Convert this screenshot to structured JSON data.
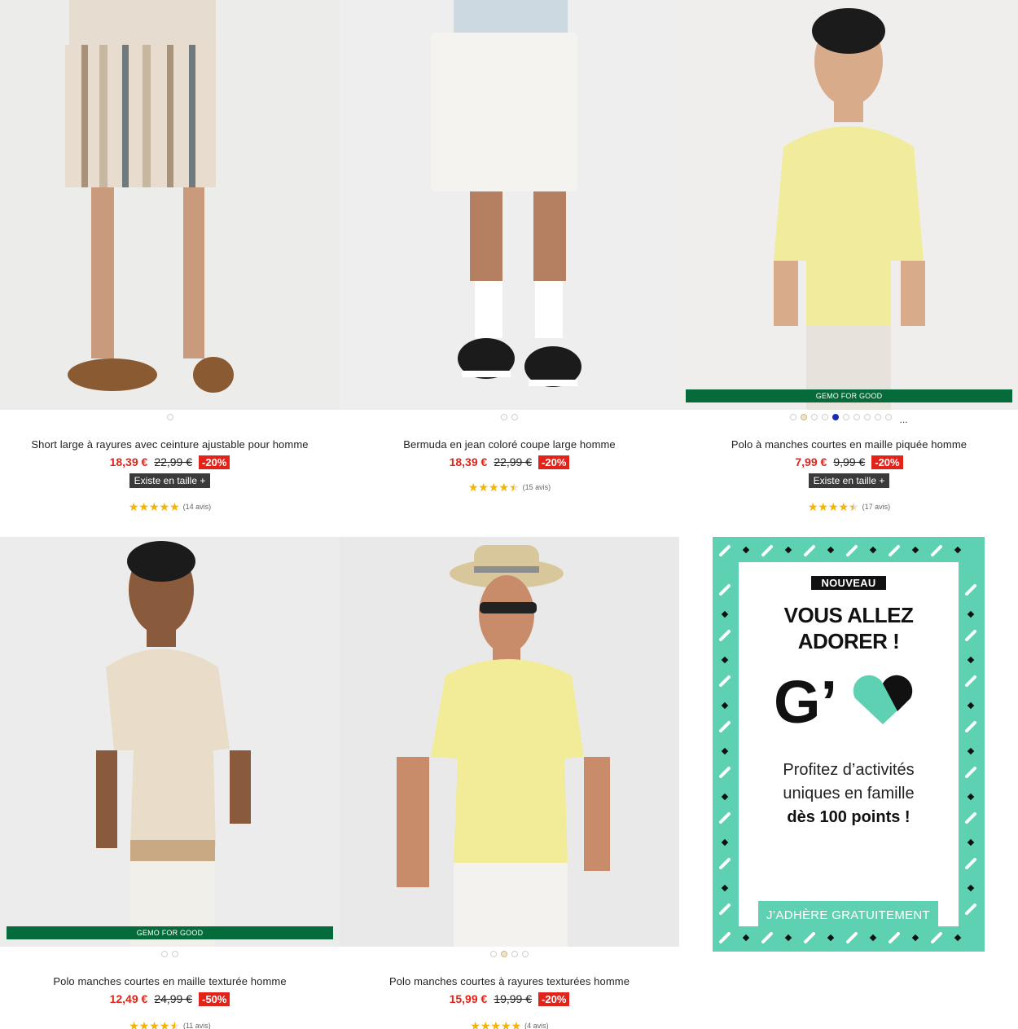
{
  "products": [
    {
      "title": "Short large à rayures avec ceinture ajustable pour homme",
      "price": "18,39 €",
      "old_price": "22,99 €",
      "discount": "-20%",
      "size_label": "Existe en taille +",
      "rating": 5,
      "reviews": "(14 avis)",
      "badge": "",
      "colors": 1,
      "active_color": 0
    },
    {
      "title": "Bermuda en jean coloré coupe large homme",
      "price": "18,39 €",
      "old_price": "22,99 €",
      "discount": "-20%",
      "size_label": "",
      "rating": 4.5,
      "reviews": "(15 avis)",
      "badge": "",
      "colors": 2,
      "active_color": 0
    },
    {
      "title": "Polo à manches courtes en maille piquée homme",
      "price": "7,99 €",
      "old_price": "9,99 €",
      "discount": "-20%",
      "size_label": "Existe en taille +",
      "rating": 4.5,
      "reviews": "(17 avis)",
      "badge": "GEMO FOR GOOD",
      "colors": 10,
      "active_color": 5,
      "more": "..."
    },
    {
      "title": "Polo manches courtes en maille texturée homme",
      "price": "12,49 €",
      "old_price": "24,99 €",
      "discount": "-50%",
      "size_label": "",
      "rating": 4.5,
      "reviews": "(11 avis)",
      "badge": "GEMO FOR GOOD",
      "colors": 2,
      "active_color": 0
    },
    {
      "title": "Polo manches courtes à rayures texturées homme",
      "price": "15,99 €",
      "old_price": "19,99 €",
      "discount": "-20%",
      "size_label": "",
      "rating": 5,
      "reviews": "(4 avis)",
      "badge": "",
      "colors": 4,
      "active_color": 1
    }
  ],
  "promo": {
    "badge": "NOUVEAU",
    "headline_1": "VOUS ALLEZ",
    "headline_2": "ADORER !",
    "logo_text": "G’",
    "text_1": "Profitez d’activités",
    "text_2": "uniques en famille",
    "text_3": "dès 100 points !",
    "cta": "J’ADHÈRE GRATUITEMENT",
    "accent_color": "#5fd1b3"
  },
  "colors": {
    "price_red": "#e2231a",
    "gemo_green": "#066b3a",
    "star_yellow": "#f4b400"
  }
}
